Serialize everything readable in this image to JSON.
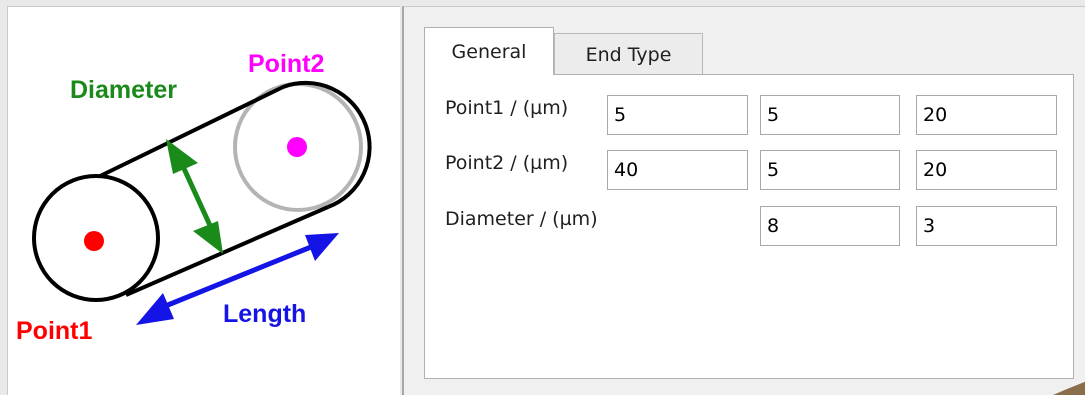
{
  "diagram": {
    "label_point1": "Point1",
    "label_point2": "Point2",
    "label_diameter": "Diameter",
    "label_length": "Length",
    "colors": {
      "point1": "#ff0000",
      "point2": "#ff00ff",
      "diameter": "#1a8a1a",
      "length": "#1414e6"
    }
  },
  "tabs": [
    {
      "label": "General",
      "active": true
    },
    {
      "label": "End Type",
      "active": false
    }
  ],
  "rows": [
    {
      "label": "Point1 / (µm)",
      "values": [
        "5",
        "5",
        "20"
      ]
    },
    {
      "label": "Point2 / (µm)",
      "values": [
        "40",
        "5",
        "20"
      ]
    },
    {
      "label": "Diameter / (µm)",
      "values": [
        "8",
        "3"
      ]
    }
  ]
}
